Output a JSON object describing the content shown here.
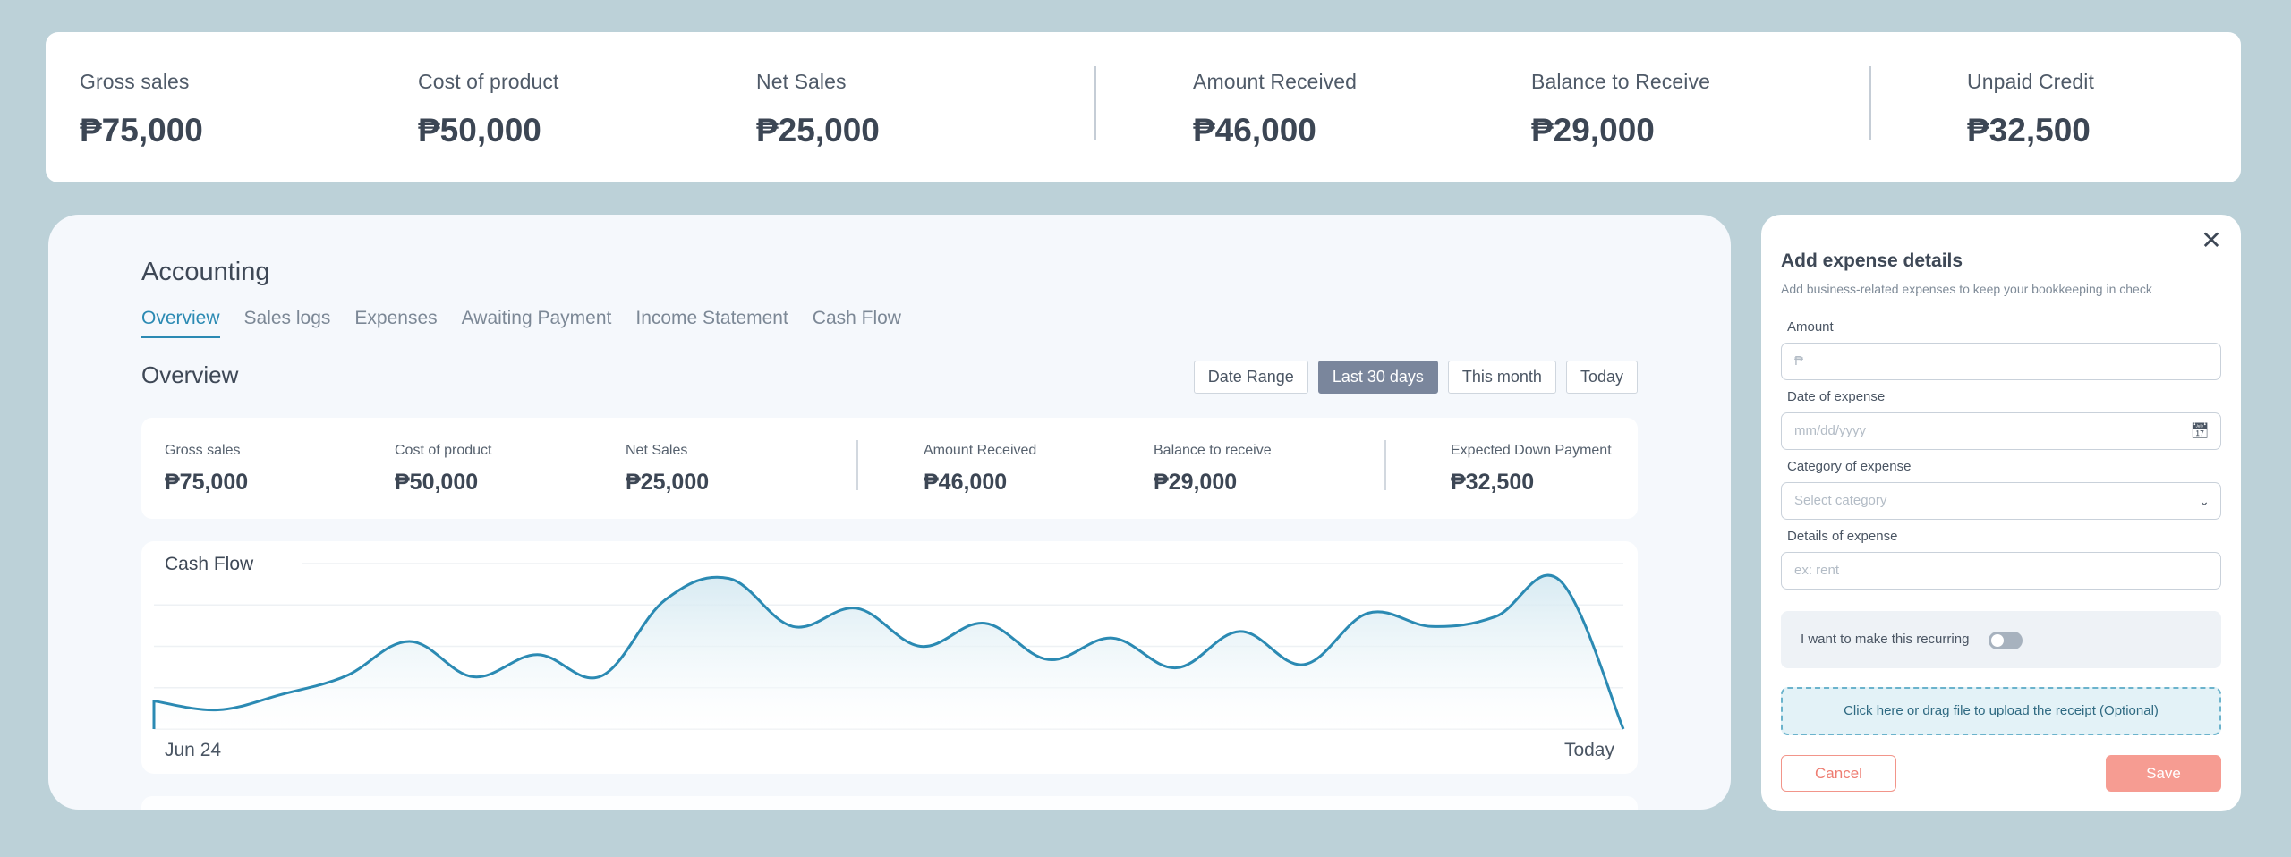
{
  "summary": [
    {
      "label": "Gross sales",
      "value": "₱75,000"
    },
    {
      "label": "Cost of product",
      "value": "₱50,000"
    },
    {
      "label": "Net Sales",
      "value": "₱25,000"
    },
    {
      "label": "Amount Received",
      "value": "₱46,000"
    },
    {
      "label": "Balance to Receive",
      "value": "₱29,000"
    },
    {
      "label": "Unpaid Credit",
      "value": "₱32,500"
    }
  ],
  "accounting": {
    "title": "Accounting",
    "tabs": [
      {
        "label": "Overview",
        "active": true
      },
      {
        "label": "Sales logs",
        "active": false
      },
      {
        "label": "Expenses",
        "active": false
      },
      {
        "label": "Awaiting Payment",
        "active": false
      },
      {
        "label": "Income Statement",
        "active": false
      },
      {
        "label": "Cash Flow",
        "active": false
      }
    ],
    "overview_title": "Overview",
    "filters": [
      {
        "label": "Date Range",
        "active": false
      },
      {
        "label": "Last 30 days",
        "active": true
      },
      {
        "label": "This month",
        "active": false
      },
      {
        "label": "Today",
        "active": false
      }
    ],
    "overview_stats": [
      {
        "label": "Gross sales",
        "value": "₱75,000"
      },
      {
        "label": "Cost of product",
        "value": "₱50,000"
      },
      {
        "label": "Net Sales",
        "value": "₱25,000"
      },
      {
        "label": "Amount Received",
        "value": "₱46,000"
      },
      {
        "label": "Balance to receive",
        "value": "₱29,000"
      },
      {
        "label": "Expected Down Payment",
        "value": "₱32,500"
      }
    ]
  },
  "chart_data": {
    "type": "area",
    "title": "Cash Flow",
    "x_start_label": "Jun 24",
    "x_end_label": "Today",
    "values": [
      0.85,
      0.58,
      1.05,
      1.6,
      2.65,
      1.58,
      2.25,
      1.6,
      3.9,
      4.55,
      3.1,
      3.65,
      2.5,
      3.2,
      2.1,
      2.75,
      1.85,
      2.95,
      1.95,
      3.5,
      3.1,
      3.4,
      4.5,
      0.0
    ],
    "ylim": [
      0,
      5
    ],
    "grid": true,
    "line_color": "#2b8ab3",
    "fill_color": "#d8ebf3"
  },
  "expense_form": {
    "close_icon": "close-icon",
    "title": "Add expense details",
    "subtitle": "Add business-related expenses to keep your bookkeeping in check",
    "amount_label": "Amount",
    "amount_placeholder": "₱",
    "date_label": "Date of expense",
    "date_placeholder": "mm/dd/yyyy",
    "category_label": "Category of expense",
    "category_placeholder": "Select category",
    "details_label": "Details of expense",
    "details_placeholder": "ex: rent",
    "recurring_label": "I want to make this recurring",
    "recurring_on": false,
    "upload_text": "Click here or drag file to upload the receipt (Optional)",
    "cancel_label": "Cancel",
    "save_label": "Save"
  },
  "colors": {
    "background": "#bcd1d8",
    "accent": "#2b8ab3",
    "save": "#f69c92",
    "cancel": "#ee7d72"
  }
}
